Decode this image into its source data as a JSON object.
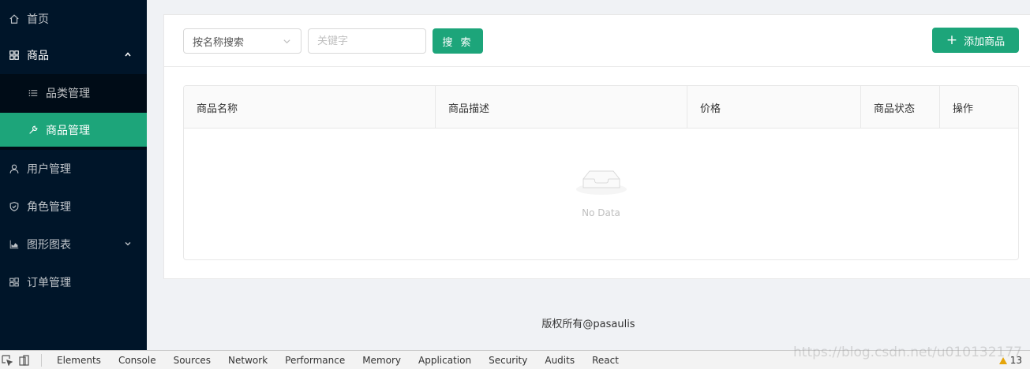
{
  "sidebar": {
    "home": "首页",
    "products": "商品",
    "category_mgmt": "品类管理",
    "product_mgmt": "商品管理",
    "user_mgmt": "用户管理",
    "role_mgmt": "角色管理",
    "charts": "图形图表",
    "order_mgmt": "订单管理"
  },
  "toolbar": {
    "search_type_selected": "按名称搜索",
    "keyword_placeholder": "关键字",
    "search_label": "搜 索",
    "add_label": "添加商品"
  },
  "table": {
    "columns": [
      "商品名称",
      "商品描述",
      "价格",
      "商品状态",
      "操作"
    ],
    "empty_text": "No Data"
  },
  "footer": "版权所有@pasaulis",
  "devtools": {
    "tabs": [
      "Elements",
      "Console",
      "Sources",
      "Network",
      "Performance",
      "Memory",
      "Application",
      "Security",
      "Audits",
      "React"
    ],
    "warning_count": "13",
    "watermark": "https://blog.csdn.net/u010132177"
  },
  "colors": {
    "sidebar_bg": "#001529",
    "accent": "#1da57a"
  }
}
